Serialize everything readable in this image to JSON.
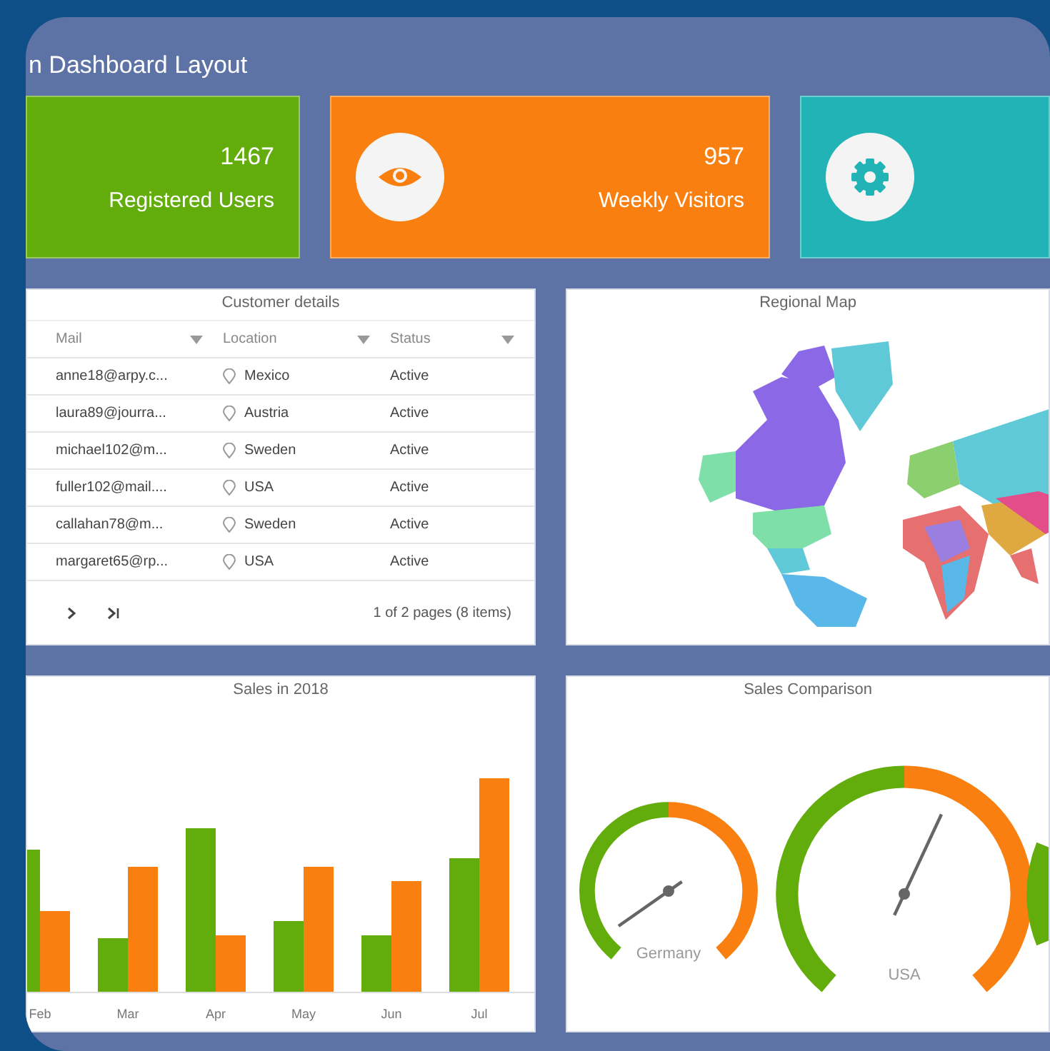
{
  "page_title": "n Dashboard Layout",
  "stat_cards": [
    {
      "kind": "users",
      "value": "1467",
      "label": "Registered Users",
      "color": "#62ac0b"
    },
    {
      "kind": "visitors",
      "value": "957",
      "label": "Weekly Visitors",
      "color": "#f98010"
    },
    {
      "kind": "settings",
      "color": "#21b3b5"
    }
  ],
  "customer_details": {
    "title": "Customer details",
    "columns": [
      "Mail",
      "Location",
      "Status"
    ],
    "rows": [
      {
        "mail": "anne18@arpy.c...",
        "location": "Mexico",
        "status": "Active"
      },
      {
        "mail": "laura89@jourra...",
        "location": "Austria",
        "status": "Active"
      },
      {
        "mail": "michael102@m...",
        "location": "Sweden",
        "status": "Active"
      },
      {
        "mail": "fuller102@mail....",
        "location": "USA",
        "status": "Active"
      },
      {
        "mail": "callahan78@m...",
        "location": "Sweden",
        "status": "Active"
      },
      {
        "mail": "margaret65@rp...",
        "location": "USA",
        "status": "Active"
      }
    ],
    "pager": {
      "summary": "1 of 2 pages (8 items)"
    }
  },
  "regional_map": {
    "title": "Regional Map"
  },
  "sales_2018": {
    "title": "Sales in 2018",
    "x_labels": [
      "Feb",
      "Mar",
      "Apr",
      "May",
      "Jun",
      "Jul"
    ]
  },
  "sales_comparison": {
    "title": "Sales Comparison",
    "gauges": [
      {
        "label": "Germany"
      },
      {
        "label": "USA"
      }
    ]
  }
}
